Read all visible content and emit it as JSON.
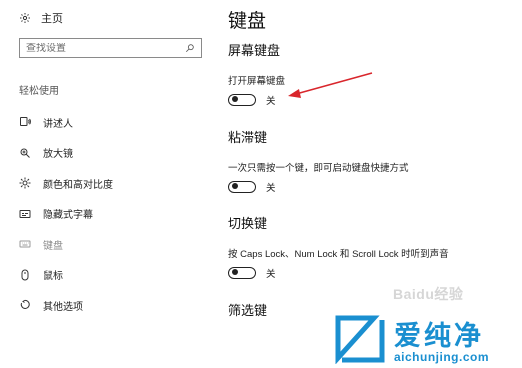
{
  "sidebar": {
    "home_label": "主页",
    "search_placeholder": "查找设置",
    "section_title": "轻松使用",
    "items": [
      {
        "label": "讲述人",
        "icon": "narrator-icon"
      },
      {
        "label": "放大镜",
        "icon": "magnifier-icon"
      },
      {
        "label": "颜色和高对比度",
        "icon": "brightness-icon"
      },
      {
        "label": "隐藏式字幕",
        "icon": "caption-icon"
      },
      {
        "label": "键盘",
        "icon": "keyboard-icon",
        "selected": true
      },
      {
        "label": "鼠标",
        "icon": "mouse-icon"
      },
      {
        "label": "其他选项",
        "icon": "other-options-icon"
      }
    ]
  },
  "main": {
    "title": "键盘",
    "groups": [
      {
        "heading": "屏幕键盘",
        "desc": "打开屏幕键盘",
        "toggle": {
          "state": "off",
          "label": "关"
        }
      },
      {
        "heading": "粘滞键",
        "desc": "一次只需按一个键，即可启动键盘快捷方式",
        "toggle": {
          "state": "off",
          "label": "关"
        }
      },
      {
        "heading": "切换键",
        "desc": "按 Caps Lock、Num Lock 和 Scroll Lock 时听到声音",
        "toggle": {
          "state": "off",
          "label": "关"
        }
      },
      {
        "heading": "筛选键"
      }
    ]
  },
  "annotation": {
    "arrow_color": "#d9262c"
  },
  "watermark": {
    "baidu": "Baidu经验",
    "brand_name": "爱纯净",
    "brand_url": "aichunjing.com",
    "brand_color": "#1a8fd0"
  }
}
